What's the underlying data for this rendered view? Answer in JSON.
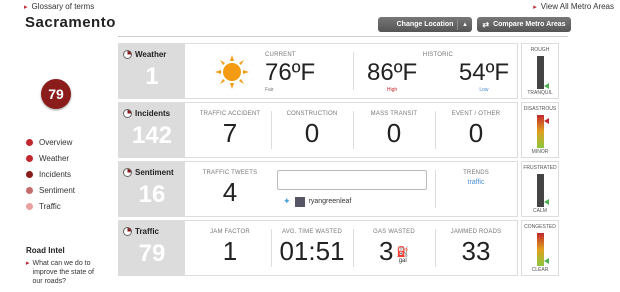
{
  "header": {
    "glossary_label": "Glossary of terms",
    "view_all_label": "View All Metro Areas",
    "city": "Sacramento",
    "change_location_label": "Change Location",
    "compare_label": "Compare Metro Areas"
  },
  "overall_score": "79",
  "nav": {
    "items": [
      {
        "label": "Overview",
        "color": "#c0282e"
      },
      {
        "label": "Weather",
        "color": "#c0282e"
      },
      {
        "label": "Incidents",
        "color": "#8a1c1c"
      },
      {
        "label": "Sentiment",
        "color": "#c56b6b"
      },
      {
        "label": "Traffic",
        "color": "#e8a0a0"
      }
    ]
  },
  "road_intel": {
    "title": "Road Intel",
    "question": "What can we do to improve the state of our roads?"
  },
  "weather": {
    "title": "Weather",
    "score": "1",
    "icon": "sun-icon",
    "current_cap": "CURRENT",
    "current_temp": "76ºF",
    "current_desc": "Fair",
    "historic_cap": "HISTORIC",
    "high_temp": "86ºF",
    "high_label": "High",
    "low_temp": "54ºF",
    "low_label": "Low",
    "gauge_top": "ROUGH",
    "gauge_bottom": "TRANQUIL",
    "gauge_level": 0.1
  },
  "incidents": {
    "title": "Incidents",
    "score": "142",
    "cells": [
      {
        "cap": "TRAFFIC ACCIDENT",
        "val": "7"
      },
      {
        "cap": "CONSTRUCTION",
        "val": "0"
      },
      {
        "cap": "MASS TRANSIT",
        "val": "0"
      },
      {
        "cap": "EVENT / OTHER",
        "val": "0"
      }
    ],
    "gauge_top": "DISASTROUS",
    "gauge_bottom": "MINOR",
    "gauge_level": 0.85
  },
  "sentiment": {
    "title": "Sentiment",
    "score": "16",
    "tweets_cap": "TRAFFIC TWEETS",
    "tweets_val": "4",
    "tweet_user": "ryangreenleaf",
    "trends_cap": "TRENDS",
    "trends_val": "traffic",
    "gauge_top": "FRUSTRATED",
    "gauge_bottom": "CALM",
    "gauge_level": 0.15
  },
  "traffic": {
    "title": "Traffic",
    "score": "79",
    "cells": [
      {
        "cap": "JAM FACTOR",
        "val": "1"
      },
      {
        "cap": "AVG. TIME WASTED",
        "val": "01:51"
      },
      {
        "cap": "GAS WASTED",
        "val": "3",
        "unit": "gal"
      },
      {
        "cap": "JAMMED ROADS",
        "val": "33"
      }
    ],
    "gauge_top": "CONGESTED",
    "gauge_bottom": "CLEAR",
    "gauge_level": 0.15
  },
  "colors": {
    "accent_red": "#c0282e",
    "dark_red": "#8a1c1c",
    "panel_gray": "#dcdcdc"
  }
}
